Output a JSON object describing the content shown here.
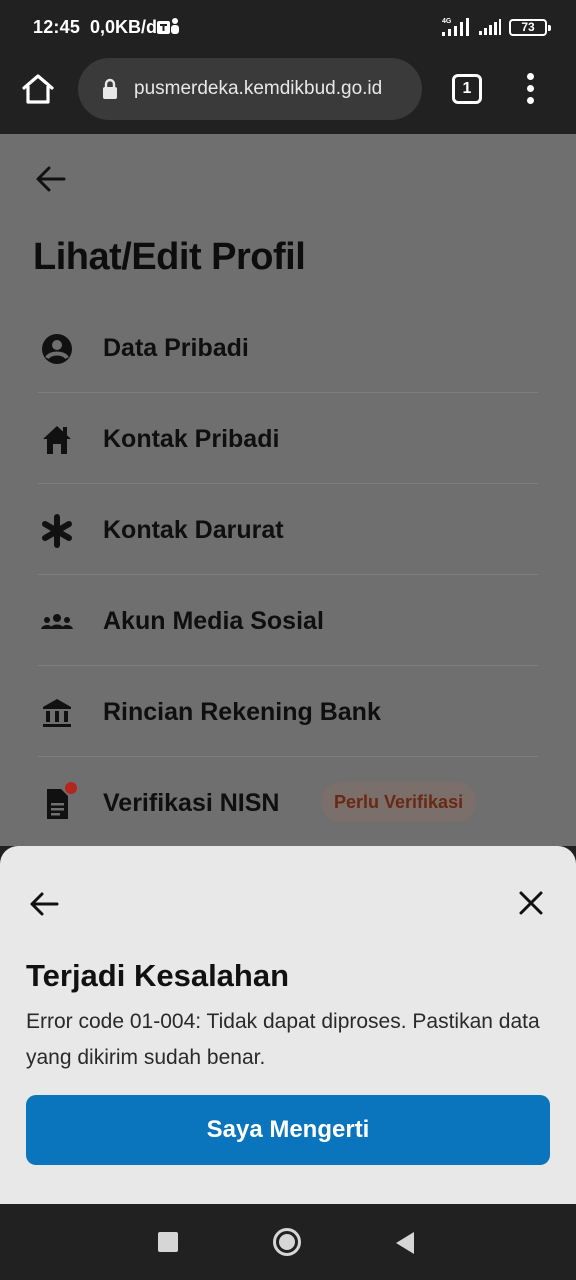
{
  "status_bar": {
    "time": "12:45",
    "speed": "0,0KB/d",
    "network": "4G",
    "battery": "73"
  },
  "browser": {
    "url": "pusmerdeka.kemdikbud.go.id",
    "tab_count": "1"
  },
  "page": {
    "title": "Lihat/Edit Profil",
    "menu_items": [
      {
        "label": "Data Pribadi",
        "icon": "account-circle-icon"
      },
      {
        "label": "Kontak Pribadi",
        "icon": "home-icon"
      },
      {
        "label": "Kontak Darurat",
        "icon": "asterisk-icon"
      },
      {
        "label": "Akun Media Sosial",
        "icon": "people-icon"
      },
      {
        "label": "Rincian Rekening Bank",
        "icon": "bank-icon"
      },
      {
        "label": "Verifikasi NISN",
        "icon": "document-icon",
        "badge": "Perlu Verifikasi"
      }
    ]
  },
  "sheet": {
    "title": "Terjadi Kesalahan",
    "message": "Error code 01-004: Tidak dapat diproses. Pastikan data yang dikirim sudah benar.",
    "button_label": "Saya Mengerti"
  },
  "colors": {
    "primary": "#0a75bc",
    "badge_text": "#6b2812",
    "notification_dot": "#b3261e"
  }
}
